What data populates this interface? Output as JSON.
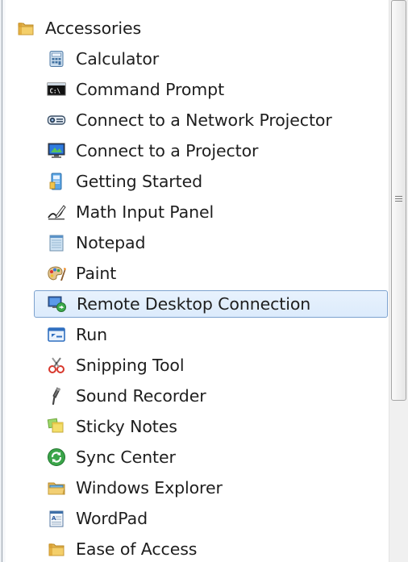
{
  "menu": {
    "items": [
      {
        "label": "Accessories",
        "icon": "folder-icon",
        "kind": "folder"
      },
      {
        "label": "Calculator",
        "icon": "calculator-icon",
        "kind": "program"
      },
      {
        "label": "Command Prompt",
        "icon": "command-prompt-icon",
        "kind": "program"
      },
      {
        "label": "Connect to a Network Projector",
        "icon": "network-projector-icon",
        "kind": "program"
      },
      {
        "label": "Connect to a Projector",
        "icon": "projector-icon",
        "kind": "program"
      },
      {
        "label": "Getting Started",
        "icon": "getting-started-icon",
        "kind": "program"
      },
      {
        "label": "Math Input Panel",
        "icon": "math-input-icon",
        "kind": "program"
      },
      {
        "label": "Notepad",
        "icon": "notepad-icon",
        "kind": "program"
      },
      {
        "label": "Paint",
        "icon": "paint-icon",
        "kind": "program"
      },
      {
        "label": "Remote Desktop Connection",
        "icon": "remote-desktop-icon",
        "kind": "program",
        "selected": true
      },
      {
        "label": "Run",
        "icon": "run-icon",
        "kind": "program"
      },
      {
        "label": "Snipping Tool",
        "icon": "snipping-tool-icon",
        "kind": "program"
      },
      {
        "label": "Sound Recorder",
        "icon": "microphone-icon",
        "kind": "program"
      },
      {
        "label": "Sticky Notes",
        "icon": "sticky-notes-icon",
        "kind": "program"
      },
      {
        "label": "Sync Center",
        "icon": "sync-icon",
        "kind": "program"
      },
      {
        "label": "Windows Explorer",
        "icon": "explorer-icon",
        "kind": "program"
      },
      {
        "label": "WordPad",
        "icon": "wordpad-icon",
        "kind": "program"
      },
      {
        "label": "Ease of Access",
        "icon": "folder-icon",
        "kind": "program"
      }
    ]
  },
  "colors": {
    "selection_border": "#7da2ce",
    "selection_fill": "#dcebfc",
    "text": "#1e1e1e"
  }
}
